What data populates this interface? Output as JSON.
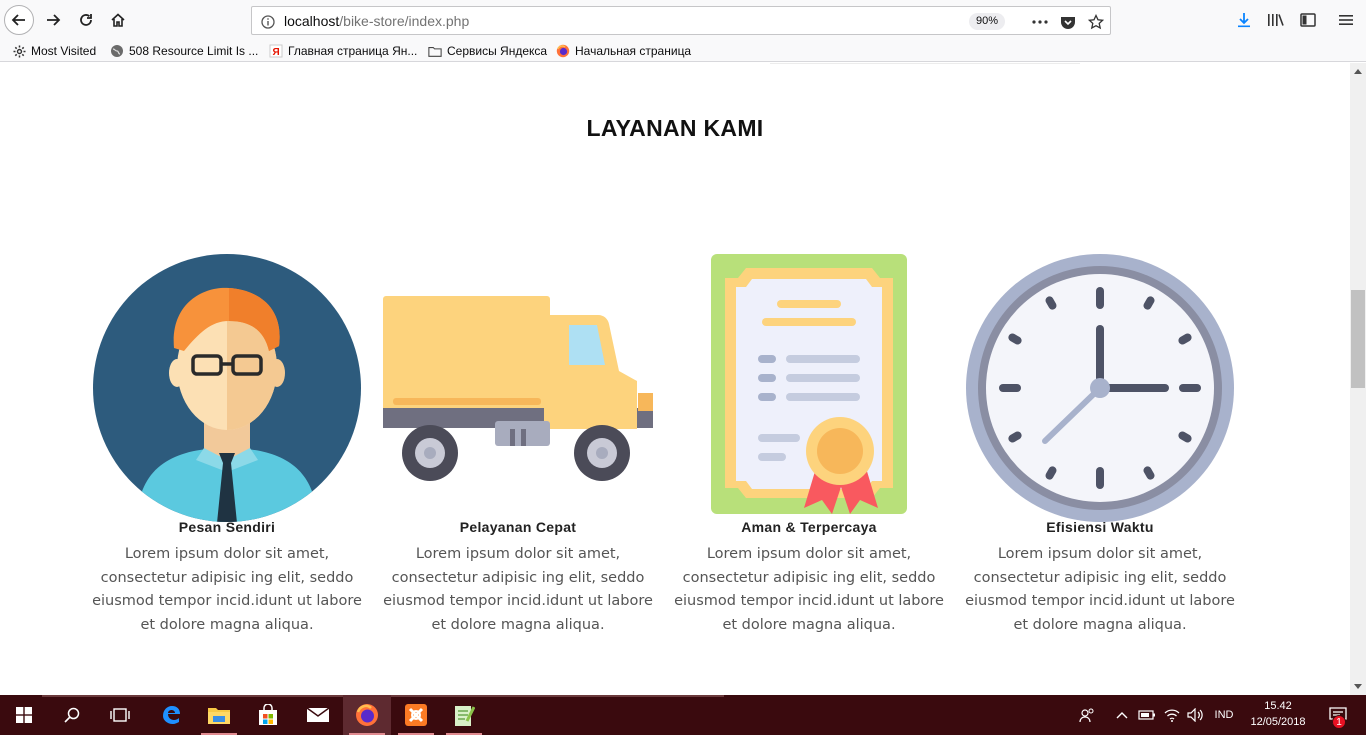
{
  "browser": {
    "url_host": "localhost",
    "url_path": "/bike-store/index.php",
    "zoom": "90%",
    "bookmarks": [
      {
        "label": "Most Visited",
        "icon": "gear-icon"
      },
      {
        "label": "508 Resource Limit Is ...",
        "icon": "globe-icon"
      },
      {
        "label": "Главная страница Ян...",
        "icon": "yandex-icon"
      },
      {
        "label": "Сервисы Яндекса",
        "icon": "folder-icon"
      },
      {
        "label": "Начальная страница",
        "icon": "firefox-icon"
      }
    ]
  },
  "section": {
    "title": "LAYANAN KAMI"
  },
  "services": [
    {
      "name": "Pesan Sendiri",
      "desc": "Lorem ipsum dolor sit amet, consectetur adipisic ing elit, seddo eiusmod tempor incid.idunt ut labore et dolore magna aliqua.",
      "icon": "person-icon"
    },
    {
      "name": "Pelayanan Cepat",
      "desc": "Lorem ipsum dolor sit amet, consectetur adipisic ing elit, seddo eiusmod tempor incid.idunt ut labore et dolore magna aliqua.",
      "icon": "truck-icon"
    },
    {
      "name": "Aman & Terpercaya",
      "desc": "Lorem ipsum dolor sit amet, consectetur adipisic ing elit, seddo eiusmod tempor incid.idunt ut labore et dolore magna aliqua.",
      "icon": "certificate-icon"
    },
    {
      "name": "Efisiensi Waktu",
      "desc": "Lorem ipsum dolor sit amet, consectetur adipisic ing elit, seddo eiusmod tempor incid.idunt ut labore et dolore magna aliqua.",
      "icon": "clock-icon"
    }
  ],
  "taskbar": {
    "language": "IND",
    "time": "15.42",
    "date": "12/05/2018",
    "notification_count": "1"
  }
}
